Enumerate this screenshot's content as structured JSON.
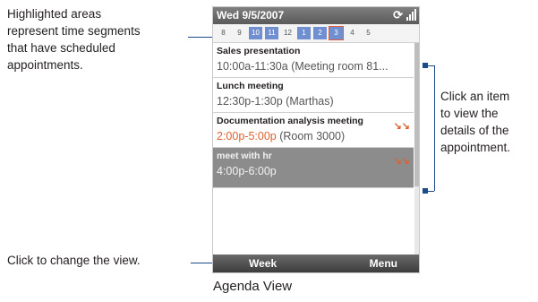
{
  "annotations": {
    "left": "Highlighted areas\nrepresent time segments\nthat have scheduled\nappointments.",
    "right": "Click an item\nto view the\ndetails of the\nappointment.",
    "bottom": "Click to change the view."
  },
  "caption": "Agenda View",
  "phone": {
    "status_bar": {
      "date": "Wed 9/5/2007",
      "sync_icon": "sync-icon",
      "signal_icon": "signal-icon"
    },
    "timeline": {
      "hours": [
        "8",
        "9",
        "10",
        "11",
        "12",
        "1",
        "2",
        "3",
        "4",
        "5"
      ],
      "busy_hours": [
        "10",
        "11",
        "1",
        "2",
        "3"
      ],
      "current_hour": "3",
      "busy_color": "#6f8fd0"
    },
    "appointments": [
      {
        "subject": "Sales presentation",
        "time": "10:00a-11:30a",
        "location": "(Meeting room 81...",
        "conflict": false
      },
      {
        "subject": "Lunch meeting",
        "time": "12:30p-1:30p",
        "location": "(Marthas)",
        "conflict": false
      },
      {
        "subject": "Documentation analysis meeting",
        "time": "2:00p-5:00p",
        "location": "(Room 3000)",
        "conflict": true
      },
      {
        "subject": "meet with hr",
        "time": "4:00p-6:00p",
        "location": "",
        "conflict": true,
        "selected": true
      }
    ],
    "softkeys": {
      "left": "Week",
      "right": "Menu"
    }
  },
  "colors": {
    "callout_line": "#1d4a8a",
    "conflict": "#e0602e",
    "selected_bg": "#8c8c8c"
  }
}
